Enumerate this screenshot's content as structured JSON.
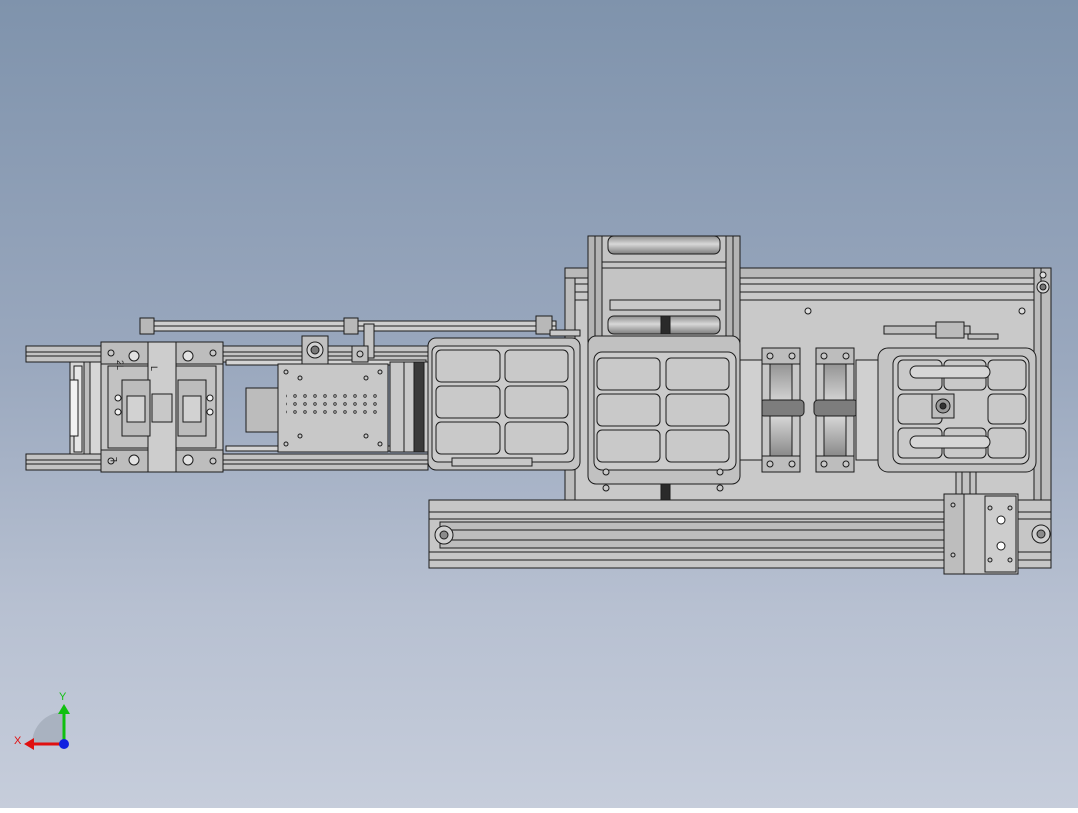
{
  "view": {
    "type": "CAD top view",
    "background_top": "#7f93ac",
    "background_bottom": "#c6cddb"
  },
  "part_labels": {
    "left_slide_top": "2L",
    "left_slide_top_small": "L",
    "left_slide_bottom": "L"
  },
  "triad": {
    "x_label": "X",
    "y_label": "Y",
    "x_color": "#e01010",
    "y_color": "#10c010",
    "z_color": "#1020e0"
  },
  "colors": {
    "metal_fill": "#c9c9c9",
    "metal_dark": "#a9a9a9",
    "roller_fill": "#b0b0b0",
    "outline": "#1c1c1c"
  }
}
